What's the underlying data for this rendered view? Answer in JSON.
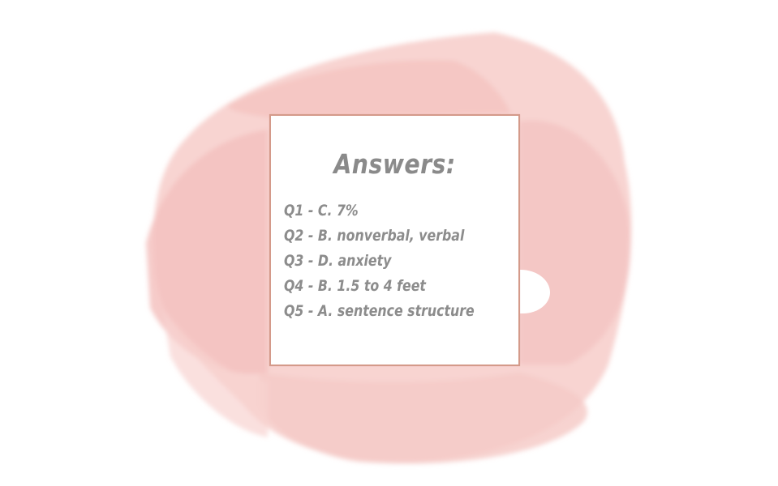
{
  "title": "Answers:",
  "answers": [
    "Q1 - C. 7%",
    "Q2 - B. nonverbal, verbal",
    "Q3 - D. anxiety",
    "Q4 - B. 1.5 to 4 feet",
    "Q5 - A. sentence structure"
  ],
  "colors": {
    "background": "#ffffff",
    "brush": "#f6c9c6",
    "frame_border": "#d49a8a",
    "text": "#8a8a8a"
  }
}
